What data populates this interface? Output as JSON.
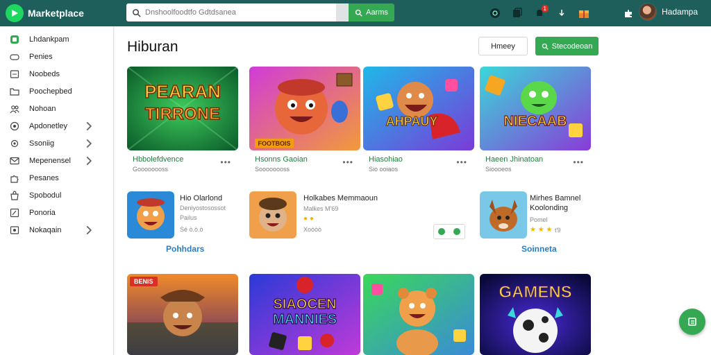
{
  "header": {
    "app_name": "Marketplace",
    "search_placeholder": "Dnshoolfoodtfo Gdtdsanea",
    "search_button": "Aarms",
    "notification_count": "1",
    "username": "Hadampa"
  },
  "sidebar": {
    "items": [
      {
        "label": "Lhdankpam",
        "icon": "square-icon",
        "chevron": false
      },
      {
        "label": "Penies",
        "icon": "gamepad-icon",
        "chevron": false
      },
      {
        "label": "Noobeds",
        "icon": "box-icon",
        "chevron": false
      },
      {
        "label": "Poochepbed",
        "icon": "folder-icon",
        "chevron": false
      },
      {
        "label": "Nohoan",
        "icon": "people-icon",
        "chevron": false
      },
      {
        "label": "Apdonetley",
        "icon": "target-icon",
        "chevron": true
      },
      {
        "label": "Ssoniig",
        "icon": "settings-icon",
        "chevron": true
      },
      {
        "label": "Mepenensel",
        "icon": "mail-icon",
        "chevron": true
      },
      {
        "label": "Pesanes",
        "icon": "puzzle-icon",
        "chevron": false
      },
      {
        "label": "Spobodul",
        "icon": "bag-icon",
        "chevron": false
      },
      {
        "label": "Ponoria",
        "icon": "edit-icon",
        "chevron": false
      },
      {
        "label": "Nokaqain",
        "icon": "image-icon",
        "chevron": true
      }
    ]
  },
  "main": {
    "title": "Hiburan",
    "secondary_button": "Hmeey",
    "primary_button": "Stecodeoan",
    "featured": [
      {
        "art_text": "PEARAN TIRRONE",
        "title": "Hbbolefdvence",
        "subtitle": "Goooooooss"
      },
      {
        "art_text": "FOOTBOIS",
        "title": "Hsonns Gaoian",
        "subtitle": "Soooooooss"
      },
      {
        "art_text": "AHPAUY",
        "title": "Hiasohiao",
        "subtitle": "Sio ooiaos"
      },
      {
        "art_text": "NIECAAB",
        "title": "Haeen Jhinatoan",
        "subtitle": "Sioooeos"
      }
    ],
    "wide": [
      {
        "title": "Hio Olarlond",
        "subtitle1": "Deniyostosossot",
        "subtitle2": "Pailus",
        "rating": "Ṡé ò.ò.ò",
        "link": "Pohhdars"
      },
      {
        "title": "Holkabes Memmaoun",
        "subtitle1": "Malkes M'69",
        "rating": "Xoòòò"
      },
      {
        "title": "Mirhes Bamnel",
        "subtitle1": "Koolonding",
        "subtitle2": "Pomel",
        "rating": "ť9",
        "link": "Soinneta"
      }
    ],
    "bottom": [
      {
        "art_text": "",
        "badge": "BENIS"
      },
      {
        "art_text": "SIAOCEN MANNIES",
        "badge": ""
      },
      {
        "art_text": "",
        "badge": ""
      },
      {
        "art_text": "GAMENS",
        "badge": ""
      }
    ]
  },
  "colors": {
    "header_bg": "#1f5f5b",
    "accent": "#34a853",
    "link": "#2a7dc0"
  }
}
